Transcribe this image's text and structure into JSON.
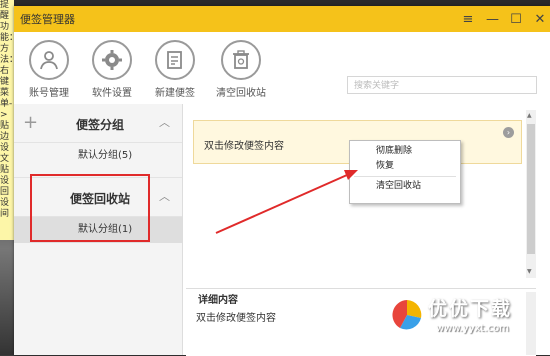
{
  "window": {
    "title": "便签管理器",
    "controls": [
      "≡",
      "—",
      "☐",
      "✕"
    ]
  },
  "background_note": {
    "lines": [
      "提醒功能：方法：右键菜单->贴边",
      "设",
      "文",
      "贴",
      "设",
      "回",
      "设",
      "间"
    ]
  },
  "toolbar": [
    {
      "label": "账号管理",
      "icon": "user-icon"
    },
    {
      "label": "软件设置",
      "icon": "gear-icon"
    },
    {
      "label": "新建便签",
      "icon": "new-note-icon"
    },
    {
      "label": "清空回收站",
      "icon": "recycle-bin-icon"
    }
  ],
  "search": {
    "placeholder": "搜索关键字"
  },
  "sidebar": {
    "notes_header": "便签分组",
    "notes_items": [
      {
        "label": "默认分组(5)"
      }
    ],
    "recycle_header": "便签回收站",
    "recycle_items": [
      {
        "label": "默认分组(1)"
      }
    ]
  },
  "notes": [
    {
      "text": "双击修改便签内容"
    }
  ],
  "context_menu": {
    "items": [
      "彻底删除",
      "恢复",
      "清空回收站"
    ]
  },
  "detail": {
    "header": "详细内容",
    "body": "双击修改便签内容"
  },
  "watermark": {
    "title": "优优下载",
    "url": "www.yyxt.com"
  },
  "colors": {
    "titlebar": "#f5c21a",
    "highlight": "#e02a2a",
    "note_bg": "#fff8df"
  }
}
